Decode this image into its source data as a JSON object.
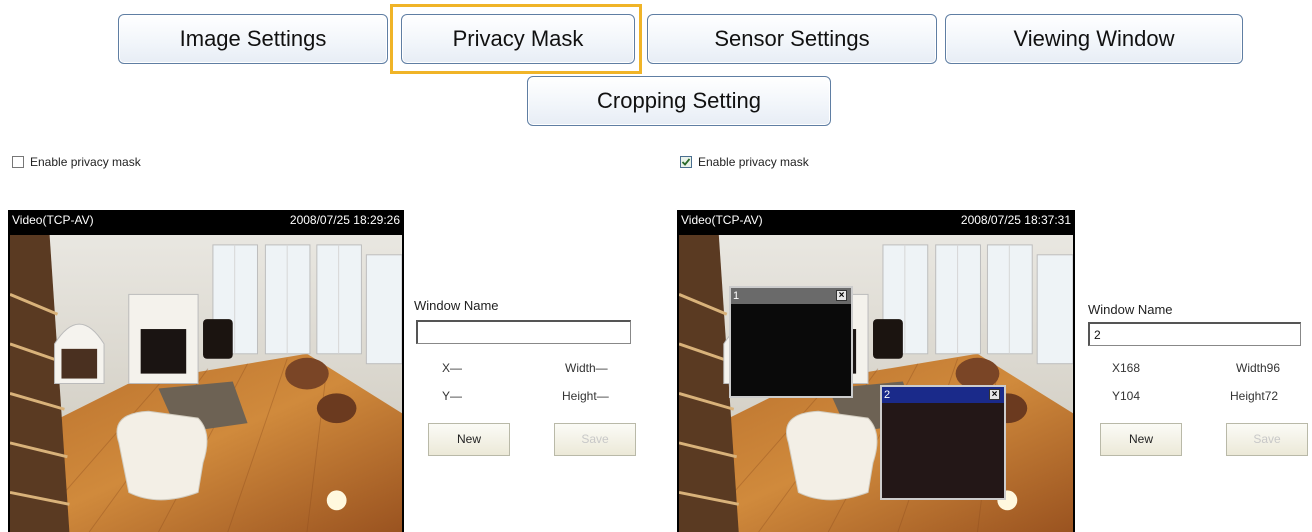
{
  "tabs": [
    {
      "label": "Image Settings",
      "selected": false
    },
    {
      "label": "Privacy Mask",
      "selected": true
    },
    {
      "label": "Sensor Settings",
      "selected": false
    },
    {
      "label": "Viewing Window",
      "selected": false
    },
    {
      "label": "Cropping Setting",
      "selected": false
    }
  ],
  "colors": {
    "selected_tab_outline": "#f0b428",
    "tab_border": "#5f7ea3",
    "active_mask_titlebar": "#1a2a8a",
    "inactive_mask_titlebar": "#6a6a6a"
  },
  "left_panel": {
    "enable_label": "Enable privacy mask",
    "enabled": false,
    "video_title": "Video(TCP-AV)",
    "timestamp": "2008/07/25 18:29:26",
    "window_name_label": "Window Name",
    "window_name_value": "",
    "x_label": "X—",
    "y_label": "Y—",
    "width_label": "Width—",
    "height_label": "Height—",
    "new_button": "New",
    "save_button": "Save"
  },
  "right_panel": {
    "enable_label": "Enable privacy mask",
    "enabled": true,
    "video_title": "Video(TCP-AV)",
    "timestamp": "2008/07/25 18:37:31",
    "window_name_label": "Window Name",
    "window_name_value": "2",
    "x_label": "X168",
    "y_label": "Y104",
    "width_label": "Width96",
    "height_label": "Height72",
    "new_button": "New",
    "save_button": "Save",
    "masks": [
      {
        "name": "1",
        "close": "×",
        "active": false
      },
      {
        "name": "2",
        "close": "×",
        "active": true
      }
    ]
  }
}
